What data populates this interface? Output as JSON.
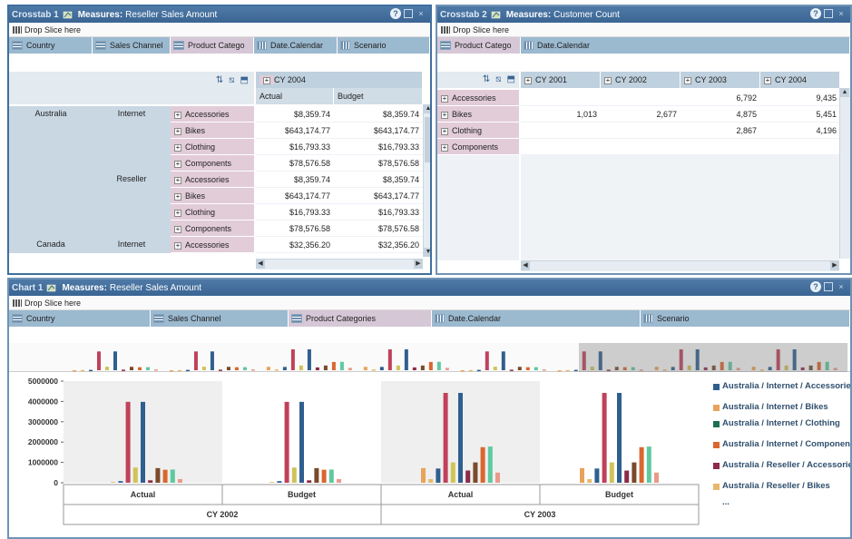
{
  "crosstab1": {
    "name": "Crosstab 1",
    "measures_label": "Measures:",
    "measure": "Reseller Sales Amount",
    "drop_slice": "Drop Slice here",
    "dims": [
      "Country",
      "Sales Channel",
      "Product Catego",
      "Date.Calendar",
      "Scenario"
    ],
    "col_group": "CY 2004",
    "col_headers": [
      "Actual",
      "Budget"
    ],
    "rows": [
      {
        "country": "Australia",
        "channel": "Internet",
        "product": "Accessories",
        "actual": "$8,359.74",
        "budget": "$8,359.74"
      },
      {
        "country": "",
        "channel": "",
        "product": "Bikes",
        "actual": "$643,174.77",
        "budget": "$643,174.77"
      },
      {
        "country": "",
        "channel": "",
        "product": "Clothing",
        "actual": "$16,793.33",
        "budget": "$16,793.33"
      },
      {
        "country": "",
        "channel": "",
        "product": "Components",
        "actual": "$78,576.58",
        "budget": "$78,576.58"
      },
      {
        "country": "",
        "channel": "Reseller",
        "product": "Accessories",
        "actual": "$8,359.74",
        "budget": "$8,359.74"
      },
      {
        "country": "",
        "channel": "",
        "product": "Bikes",
        "actual": "$643,174.77",
        "budget": "$643,174.77"
      },
      {
        "country": "",
        "channel": "",
        "product": "Clothing",
        "actual": "$16,793.33",
        "budget": "$16,793.33"
      },
      {
        "country": "",
        "channel": "",
        "product": "Components",
        "actual": "$78,576.58",
        "budget": "$78,576.58"
      },
      {
        "country": "Canada",
        "channel": "Internet",
        "product": "Accessories",
        "actual": "$32,356.20",
        "budget": "$32,356.20"
      }
    ]
  },
  "crosstab2": {
    "name": "Crosstab 2",
    "measures_label": "Measures:",
    "measure": "Customer Count",
    "drop_slice": "Drop Slice here",
    "dims": [
      "Product Catego",
      "Date.Calendar"
    ],
    "col_headers": [
      "CY 2001",
      "CY 2002",
      "CY 2003",
      "CY 2004"
    ],
    "rows": [
      {
        "product": "Accessories",
        "values": [
          "",
          "",
          "6,792",
          "9,435"
        ]
      },
      {
        "product": "Bikes",
        "values": [
          "1,013",
          "2,677",
          "4,875",
          "5,451"
        ]
      },
      {
        "product": "Clothing",
        "values": [
          "",
          "",
          "2,867",
          "4,196"
        ]
      },
      {
        "product": "Components",
        "values": [
          "",
          "",
          "",
          ""
        ]
      }
    ]
  },
  "chart1": {
    "name": "Chart 1",
    "measures_label": "Measures:",
    "measure": "Reseller Sales Amount",
    "drop_slice": "Drop Slice here",
    "dims": [
      "Country",
      "Sales Channel",
      "Product Categories",
      "Date.Calendar",
      "Scenario"
    ],
    "legend": [
      {
        "label": "Australia / Internet / Accessories",
        "color": "#2f5f8f"
      },
      {
        "label": "Australia / Internet / Bikes",
        "color": "#e8a35a"
      },
      {
        "label": "Australia / Internet / Clothing",
        "color": "#1f6f4f"
      },
      {
        "label": "Australia / Internet / Components",
        "color": "#d9672f"
      },
      {
        "label": "Australia / Reseller / Accessories",
        "color": "#8c2b4a"
      },
      {
        "label": "Australia / Reseller / Bikes",
        "color": "#e8b86a"
      },
      {
        "label": "...",
        "color": ""
      }
    ]
  },
  "chart_data": {
    "type": "bar",
    "y_ticks": [
      "5000000",
      "4000000",
      "3000000",
      "2000000",
      "1000000",
      "0"
    ],
    "ylim": [
      0,
      5000000
    ],
    "groups": [
      {
        "year": "CY 2002",
        "scenarios": [
          "Actual",
          "Budget"
        ]
      },
      {
        "year": "CY 2003",
        "scenarios": [
          "Actual",
          "Budget"
        ]
      }
    ],
    "bar_colors": [
      "#e8a35a",
      "#e8b86a",
      "#2f5f8f",
      "#c0415a",
      "#cfc35a",
      "#2f5f8f",
      "#8c2b4a",
      "#7a4a2a",
      "#d9672f",
      "#5fc9a0",
      "#e89a8a"
    ],
    "clusters": [
      {
        "label": "CY 2002 / Actual",
        "values": [
          0,
          40000,
          80000,
          3980000,
          750000,
          3980000,
          120000,
          720000,
          640000,
          650000,
          180000
        ]
      },
      {
        "label": "CY 2002 / Budget",
        "values": [
          0,
          40000,
          80000,
          3980000,
          750000,
          3980000,
          120000,
          720000,
          640000,
          650000,
          180000
        ]
      },
      {
        "label": "CY 2003 / Actual",
        "values": [
          720000,
          180000,
          700000,
          4420000,
          1000000,
          4420000,
          600000,
          1000000,
          1750000,
          1780000,
          500000
        ]
      },
      {
        "label": "CY 2003 / Budget",
        "values": [
          720000,
          180000,
          700000,
          4420000,
          1000000,
          4420000,
          600000,
          1000000,
          1750000,
          1780000,
          500000
        ]
      }
    ]
  }
}
